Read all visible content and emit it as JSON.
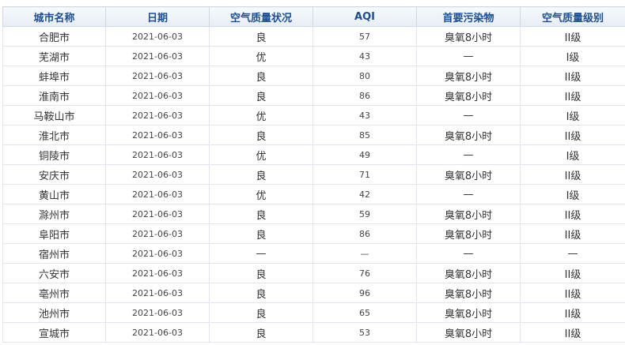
{
  "table": {
    "headers": [
      "城市名称",
      "日期",
      "空气质量状况",
      "AQI",
      "首要污染物",
      "空气质量级别"
    ],
    "rows": [
      [
        "合肥市",
        "2021-06-03",
        "良",
        "57",
        "臭氧8小时",
        "II级"
      ],
      [
        "芜湖市",
        "2021-06-03",
        "优",
        "43",
        "—",
        "I级"
      ],
      [
        "蚌埠市",
        "2021-06-03",
        "良",
        "80",
        "臭氧8小时",
        "II级"
      ],
      [
        "淮南市",
        "2021-06-03",
        "良",
        "86",
        "臭氧8小时",
        "II级"
      ],
      [
        "马鞍山市",
        "2021-06-03",
        "优",
        "43",
        "—",
        "I级"
      ],
      [
        "淮北市",
        "2021-06-03",
        "良",
        "85",
        "臭氧8小时",
        "II级"
      ],
      [
        "铜陵市",
        "2021-06-03",
        "优",
        "49",
        "—",
        "I级"
      ],
      [
        "安庆市",
        "2021-06-03",
        "良",
        "71",
        "臭氧8小时",
        "II级"
      ],
      [
        "黄山市",
        "2021-06-03",
        "优",
        "42",
        "—",
        "I级"
      ],
      [
        "滁州市",
        "2021-06-03",
        "良",
        "59",
        "臭氧8小时",
        "II级"
      ],
      [
        "阜阳市",
        "2021-06-03",
        "良",
        "86",
        "臭氧8小时",
        "II级"
      ],
      [
        "宿州市",
        "2021-06-03",
        "—",
        "—",
        "—",
        "—"
      ],
      [
        "六安市",
        "2021-06-03",
        "良",
        "76",
        "臭氧8小时",
        "II级"
      ],
      [
        "亳州市",
        "2021-06-03",
        "良",
        "96",
        "臭氧8小时",
        "II级"
      ],
      [
        "池州市",
        "2021-06-03",
        "良",
        "65",
        "臭氧8小时",
        "II级"
      ],
      [
        "宣城市",
        "2021-06-03",
        "良",
        "53",
        "臭氧8小时",
        "II级"
      ]
    ]
  }
}
